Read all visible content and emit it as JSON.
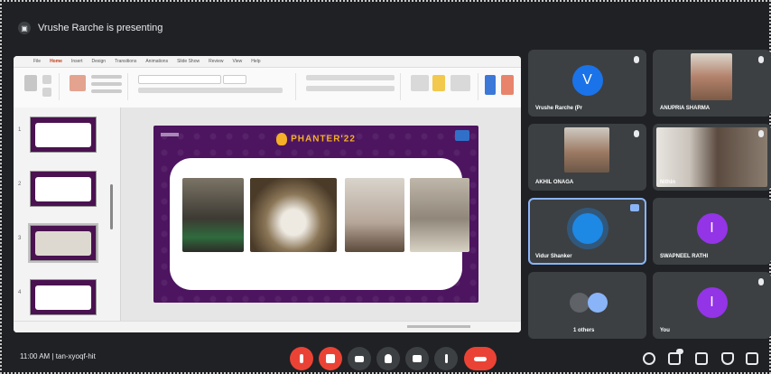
{
  "presenting_banner": "Vrushe Rarche is presenting",
  "powerpoint": {
    "tabs": [
      "File",
      "Home",
      "Insert",
      "Design",
      "Transitions",
      "Animations",
      "Slide Show",
      "Review",
      "View",
      "Help"
    ],
    "thumbnail_numbers": [
      "1",
      "2",
      "3",
      "4"
    ],
    "slide_brand": "PHANTER'22"
  },
  "participants": [
    {
      "name": "Vrushe Rarche (Pr",
      "avatar_letter": "V",
      "avatar_color": "#1a73e8",
      "type": "avatar"
    },
    {
      "name": "ANUPRIA SHARMA",
      "type": "video"
    },
    {
      "name": "AKHIL ONAGA",
      "type": "video"
    },
    {
      "name": "Nithin",
      "type": "video"
    },
    {
      "name": "Vidur Shanker",
      "type": "speaking",
      "avatar_color": "#1e88e5"
    },
    {
      "name": "SWAPNEEL RATHI",
      "avatar_letter": "I",
      "avatar_color": "#9334e6",
      "type": "avatar"
    },
    {
      "name": "1 others",
      "type": "others"
    },
    {
      "name": "You",
      "avatar_letter": "I",
      "avatar_color": "#9334e6",
      "type": "avatar"
    }
  ],
  "meeting": {
    "time": "11:00 AM",
    "code": "tan-xyoqf-hit"
  },
  "colors": {
    "end_call": "#ea4335",
    "control_gray": "#3c4043",
    "background": "#202124",
    "accent": "#8ab4f8"
  }
}
